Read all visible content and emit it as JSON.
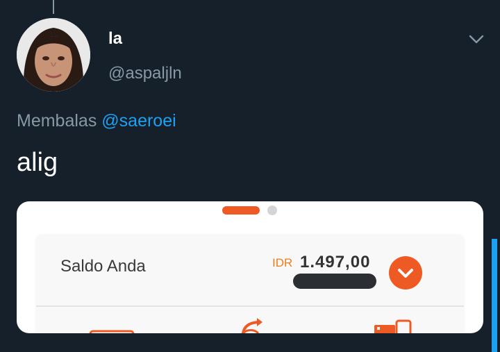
{
  "tweet": {
    "display_name": "la",
    "handle": "@aspaljln",
    "reply_prefix": "Membalas",
    "reply_mention": "@saeroei",
    "text": "alig"
  },
  "media": {
    "carousel_pages": 2,
    "carousel_active_index": 0,
    "balance_label": "Saldo Anda",
    "currency": "IDR",
    "amount": "1.497,00",
    "icons": [
      "expand-chevron-icon",
      "wallet-icon",
      "transfer-icon",
      "shopping-icon"
    ]
  },
  "colors": {
    "background": "#15202b",
    "muted_text": "#8899a6",
    "link": "#1da1f2",
    "accent_orange": "#ee5a24"
  }
}
